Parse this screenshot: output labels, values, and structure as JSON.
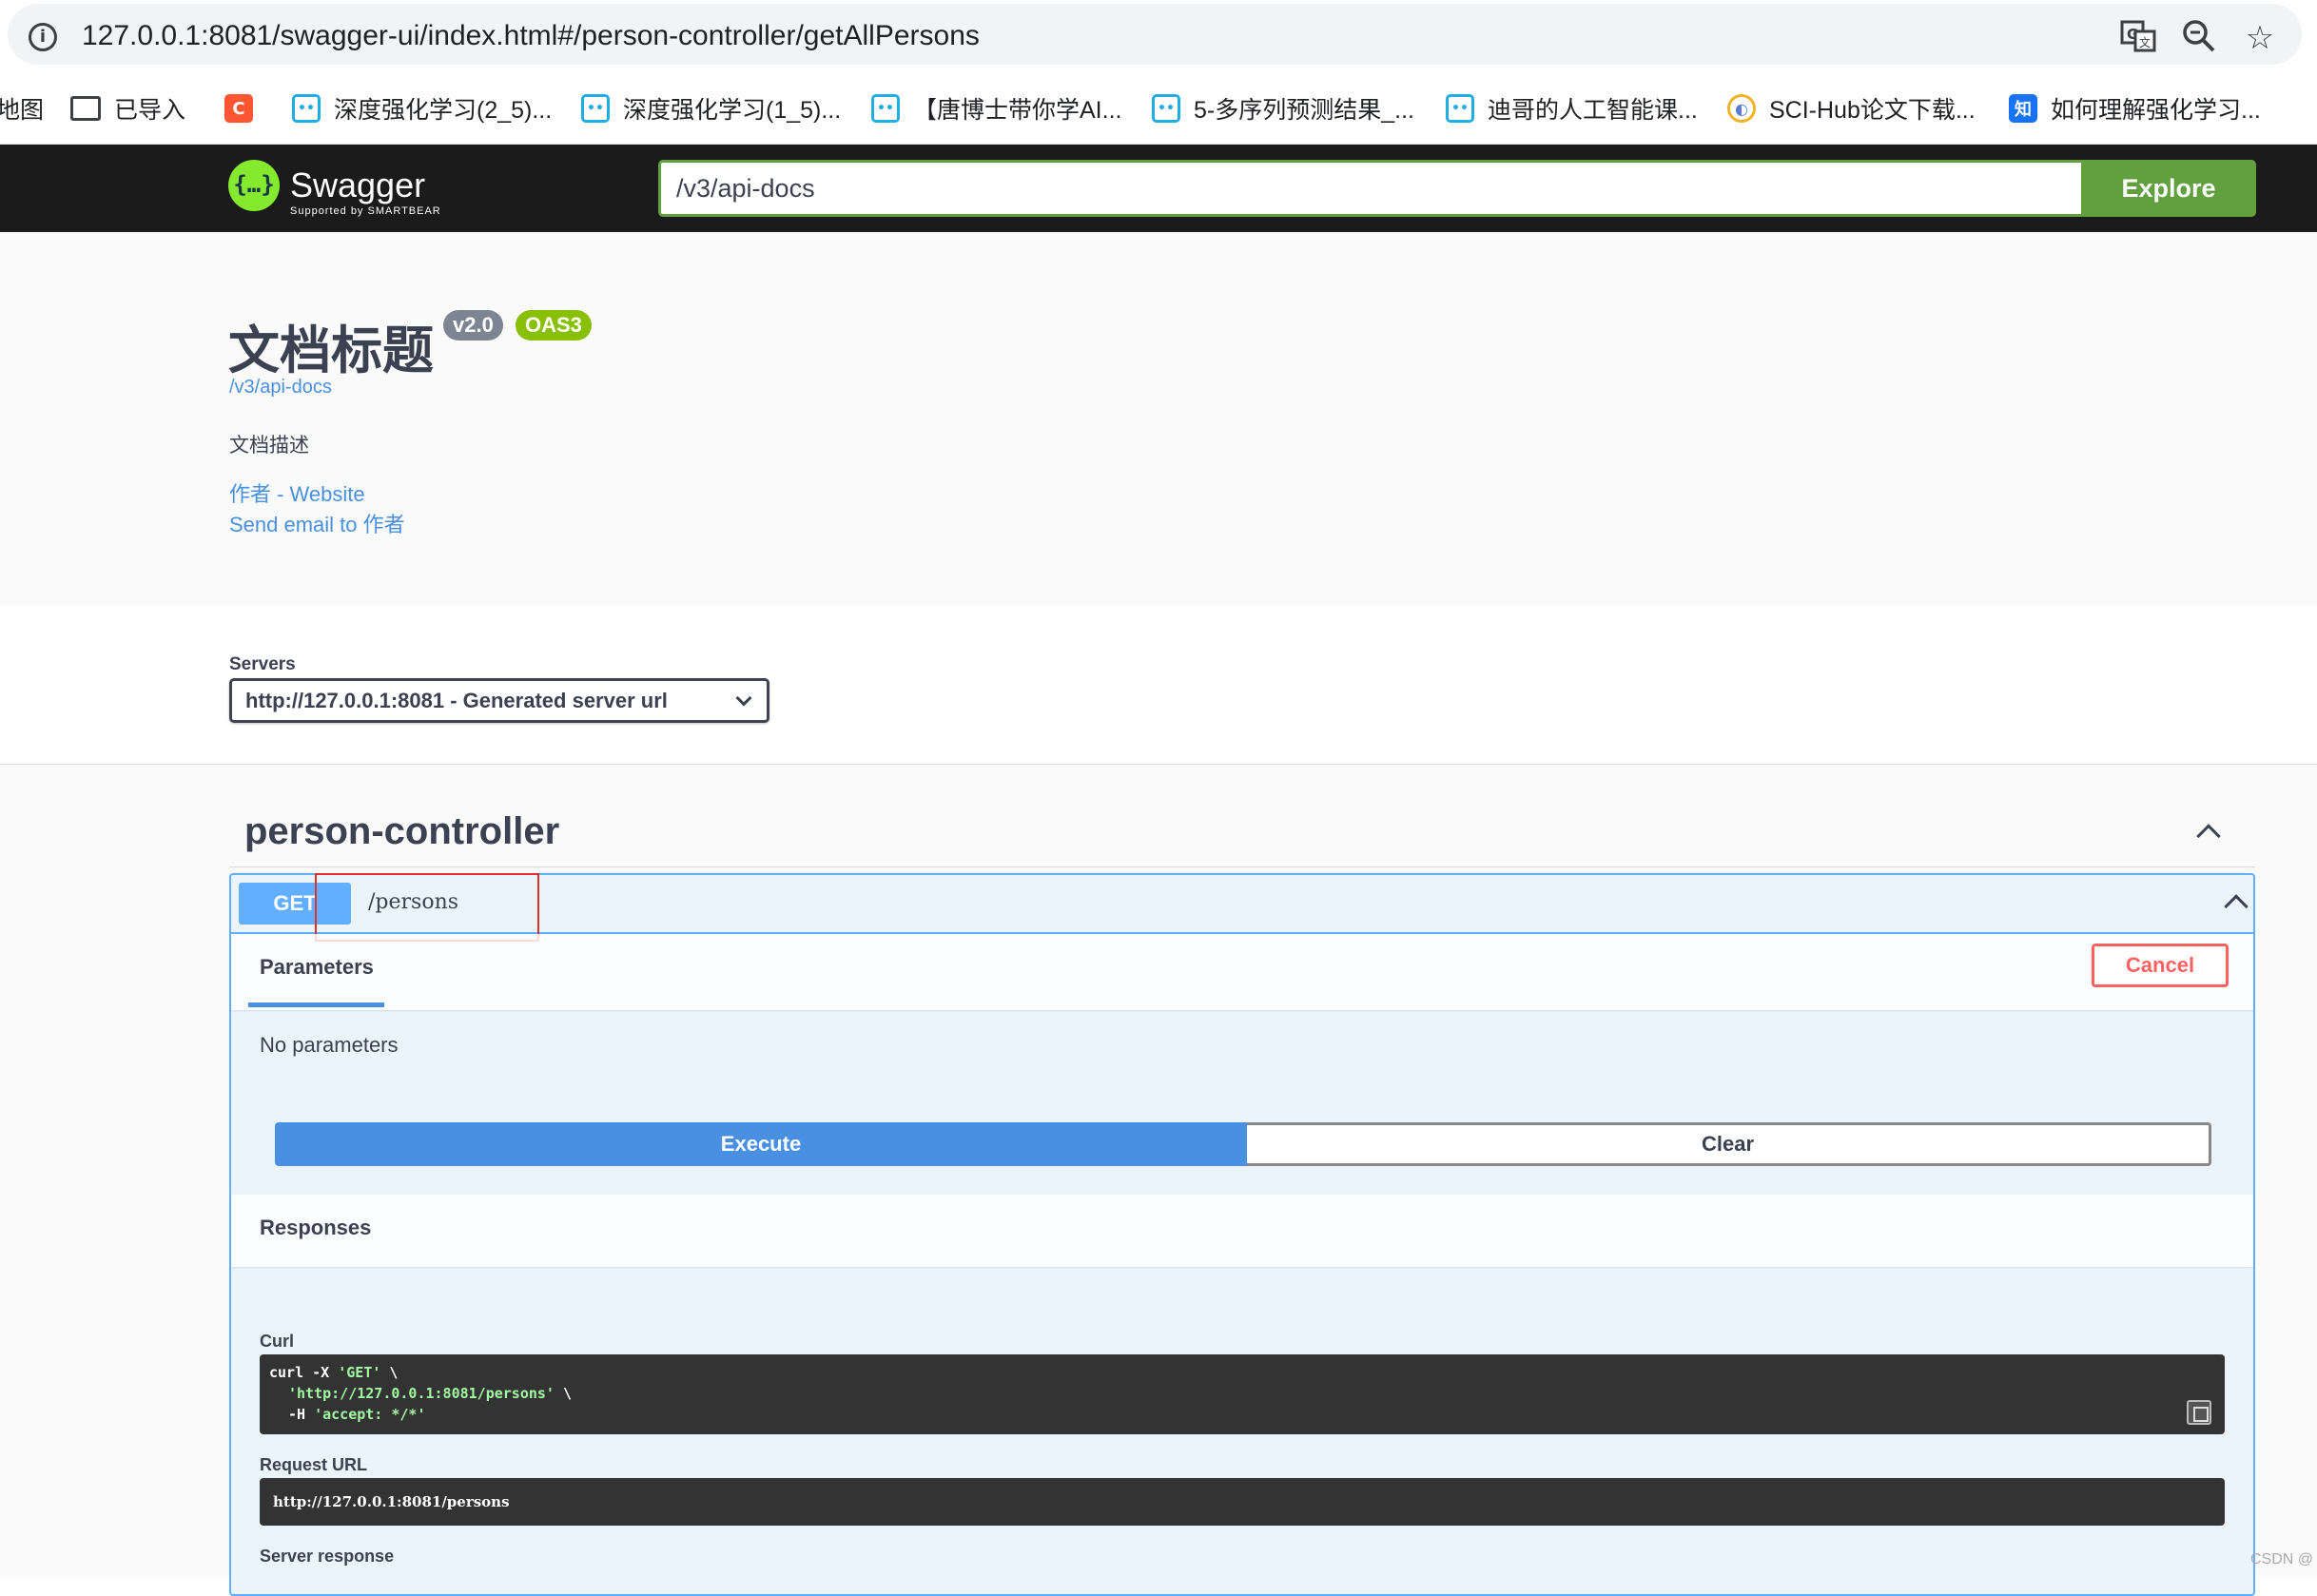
{
  "browser": {
    "url": "127.0.0.1:8081/swagger-ui/index.html#/person-controller/getAllPersons",
    "icons": [
      "info-icon",
      "translate-icon",
      "zoom-icon",
      "star-icon"
    ]
  },
  "bookmarks": [
    {
      "label": "地图",
      "icon": "none"
    },
    {
      "label": "已导入",
      "icon": "folder-icon"
    },
    {
      "label": "",
      "icon": "csdn-icon"
    },
    {
      "label": "深度强化学习(2_5)...",
      "icon": "bilibili-icon"
    },
    {
      "label": "深度强化学习(1_5)...",
      "icon": "bilibili-icon"
    },
    {
      "label": "【唐博士带你学AI...",
      "icon": "bilibili-icon"
    },
    {
      "label": "5-多序列预测结果_...",
      "icon": "bilibili-icon"
    },
    {
      "label": "迪哥的人工智能课...",
      "icon": "bilibili-icon"
    },
    {
      "label": "SCI-Hub论文下载...",
      "icon": "scihub-icon"
    },
    {
      "label": "如何理解强化学习...",
      "icon": "zhihu-icon"
    }
  ],
  "topbar": {
    "logo_text": "Swagger",
    "logo_sub": "Supported by SMARTBEAR",
    "spec_url": "/v3/api-docs",
    "explore_label": "Explore"
  },
  "info": {
    "title": "文档标题",
    "version_badge": "v2.0",
    "oas_badge": "OAS3",
    "spec_link": "/v3/api-docs",
    "description": "文档描述",
    "author_website": "作者 - Website",
    "author_email": "Send email to 作者"
  },
  "servers": {
    "label": "Servers",
    "selected": "http://127.0.0.1:8081 - Generated server url"
  },
  "tag": {
    "name": "person-controller"
  },
  "operation": {
    "method": "GET",
    "path": "/persons",
    "params_tab": "Parameters",
    "cancel_label": "Cancel",
    "no_params": "No parameters",
    "execute_label": "Execute",
    "clear_label": "Clear",
    "responses_title": "Responses",
    "curl_label": "Curl",
    "curl": {
      "line1_cmd": "curl -X ",
      "line1_str": "'GET'",
      "line1_tail": " \\",
      "line2_str": "'http://127.0.0.1:8081/persons'",
      "line2_tail": " \\",
      "line3_cmd": "-H ",
      "line3_str": "'accept: */*'"
    },
    "request_url_label": "Request URL",
    "request_url": "http://127.0.0.1:8081/persons",
    "server_response_label": "Server response"
  },
  "watermark": "CSDN @",
  "colors": {
    "get": "#61affe",
    "execute": "#4990e2",
    "explore": "#62a03f",
    "cancel": "#ff6060",
    "oas_badge": "#89bf04",
    "version_badge": "#7d8492",
    "highlight": "#e03131"
  }
}
